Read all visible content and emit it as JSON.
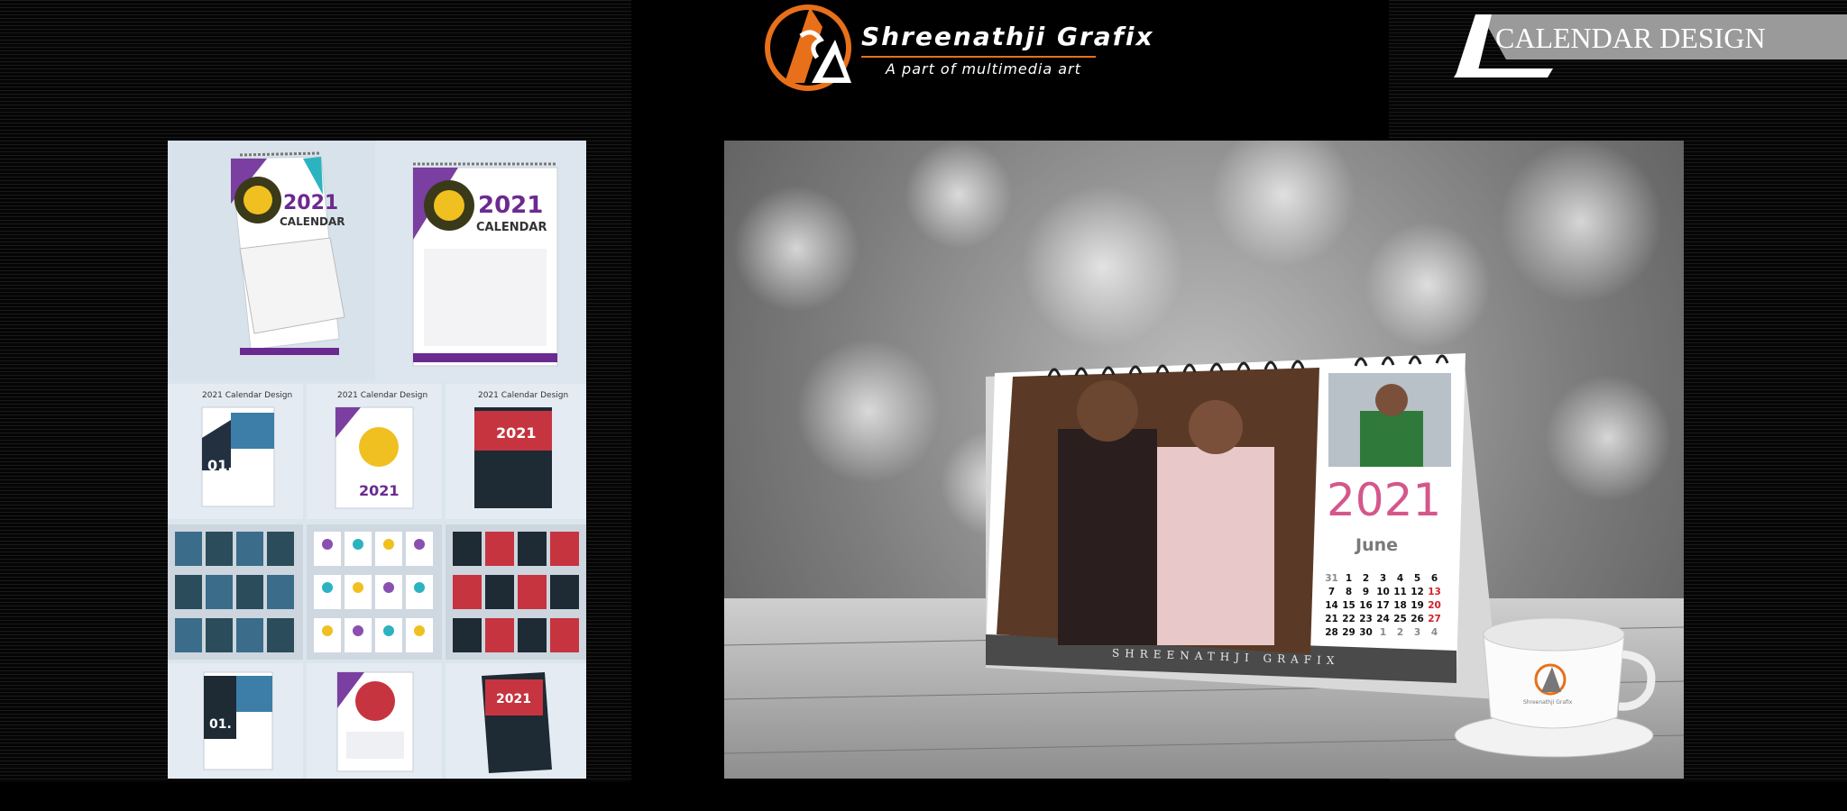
{
  "brand": {
    "name": "Shreenathji Grafix",
    "tagline": "A part of multimedia art",
    "accent_color": "#e8701a"
  },
  "banner": {
    "title": "CALENDAR DESIGN"
  },
  "collage": {
    "labels": [
      "2021 Calendar Design",
      "2021 Calendar Design",
      "2021 Calendar Design"
    ]
  },
  "desk_calendar": {
    "year": "2021",
    "month": "June",
    "brand_strip": "SHREENATHJI GRAFIX",
    "weeks": [
      [
        "31",
        "1",
        "2",
        "3",
        "4",
        "5",
        "6"
      ],
      [
        "7",
        "8",
        "9",
        "10",
        "11",
        "12",
        "13"
      ],
      [
        "14",
        "15",
        "16",
        "17",
        "18",
        "19",
        "20"
      ],
      [
        "21",
        "22",
        "23",
        "24",
        "25",
        "26",
        "27"
      ],
      [
        "28",
        "29",
        "30",
        "1",
        "2",
        "3",
        "4"
      ]
    ],
    "year_color": "#d4578b",
    "sunday_color": "#d0202a"
  },
  "cup": {
    "brand": "Shreenathji Grafix"
  }
}
